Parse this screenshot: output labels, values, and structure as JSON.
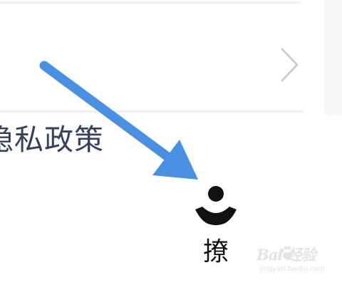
{
  "settings_list": {
    "privacy_policy_label": "隐私政策"
  },
  "bottom_nav": {
    "profile_label": "撩"
  },
  "watermark": {
    "brand": "Bai 经验",
    "url": "jingyan.baidu.com"
  },
  "colors": {
    "arrow": "#4a90e2",
    "link_text": "#36415e",
    "chevron": "#c8c8c8",
    "nav_icon": "#111111"
  },
  "icons": {
    "row_chevron": "chevron-right-icon",
    "nav_icon": "profile-icon",
    "annotation": "arrow-icon"
  }
}
